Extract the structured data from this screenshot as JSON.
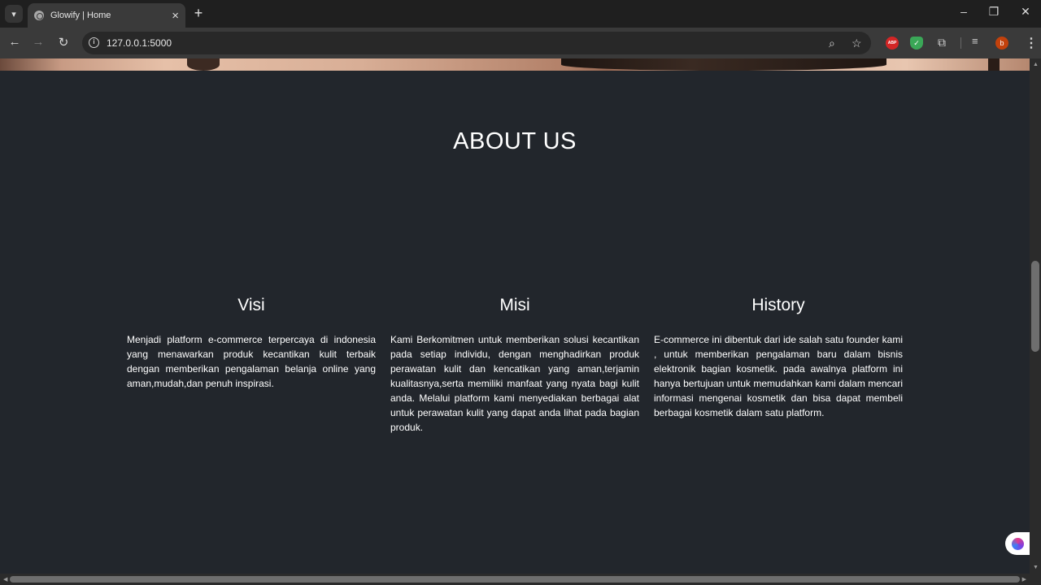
{
  "browser": {
    "tab_title": "Glowify | Home",
    "url": "127.0.0.1:5000",
    "profile_initial": "b",
    "adblock_label": "ABP"
  },
  "page": {
    "about_heading": "ABOUT US",
    "columns": [
      {
        "title": "Visi",
        "text": "Menjadi platform e-commerce terpercaya di indonesia yang menawarkan produk kecantikan kulit terbaik dengan memberikan pengalaman belanja online yang aman,mudah,dan penuh inspirasi."
      },
      {
        "title": "Misi",
        "text": "Kami Berkomitmen untuk memberikan solusi kecantikan pada setiap individu, dengan menghadirkan produk perawatan kulit dan kencatikan yang aman,terjamin kualitasnya,serta memiliki manfaat yang nyata bagi kulit anda. Melalui platform kami menyediakan berbagai alat untuk perawatan kulit yang dapat anda lihat pada bagian produk."
      },
      {
        "title": "History",
        "text": "E-commerce ini dibentuk dari ide salah satu founder kami , untuk memberikan pengalaman baru dalam bisnis elektronik bagian kosmetik. pada awalnya platform ini hanya bertujuan untuk memudahkan kami dalam mencari informasi mengenai kosmetik dan bisa dapat membeli berbagai kosmetik dalam satu platform."
      }
    ]
  },
  "icons": {
    "tab_search": "chevron-down-icon",
    "back": "arrow-left-icon",
    "forward": "arrow-right-icon",
    "reload": "reload-icon",
    "site_info": "info-icon",
    "zoom": "zoom-icon",
    "bookmark": "star-icon",
    "extensions": "puzzle-icon",
    "media": "media-control-icon",
    "menu": "kebab-menu-icon"
  },
  "colors": {
    "page_background": "#22262c",
    "text": "#ffffff",
    "browser_frame": "#1f1f1f",
    "toolbar": "#3a3a3a"
  }
}
